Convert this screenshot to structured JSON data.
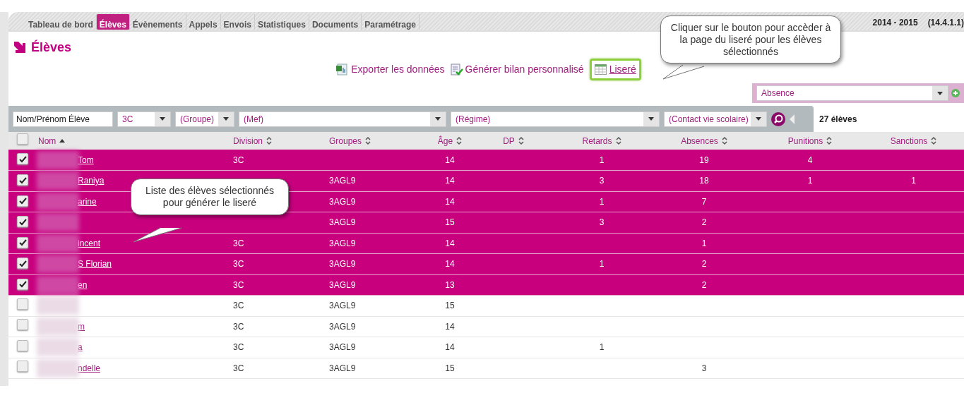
{
  "tabs": [
    {
      "label": "Tableau de bord",
      "selected": false
    },
    {
      "label": "Élèves",
      "selected": true
    },
    {
      "label": "Évènements",
      "selected": false
    },
    {
      "label": "Appels",
      "selected": false
    },
    {
      "label": "Envois",
      "selected": false
    },
    {
      "label": "Statistiques",
      "selected": false
    },
    {
      "label": "Documents",
      "selected": false
    },
    {
      "label": "Paramétrage",
      "selected": false
    }
  ],
  "school_year": "2014 - 2015",
  "version": "(14.4.1.1)",
  "page_title": "Élèves",
  "actions": [
    {
      "label": "Exporter les données",
      "kind": "export",
      "highlighted": false
    },
    {
      "label": "Générer bilan personnalisé",
      "kind": "report",
      "highlighted": false
    },
    {
      "label": "Liseré",
      "kind": "table",
      "highlighted": true
    }
  ],
  "event_select": {
    "value": "Absence"
  },
  "filters": [
    {
      "kind": "text",
      "value": "Nom/Prénom Élève"
    },
    {
      "kind": "select",
      "value": "3C"
    },
    {
      "kind": "select",
      "value": "(Groupe)"
    },
    {
      "kind": "select",
      "value": "(Mef)"
    },
    {
      "kind": "select",
      "value": "(Régime)"
    },
    {
      "kind": "select",
      "value": "(Contact vie scolaire)"
    }
  ],
  "student_count": "27 élèves",
  "table": {
    "all_checked": false,
    "columns": [
      {
        "label": "Nom",
        "sorted": true
      },
      {
        "label": "Division",
        "sorted": false
      },
      {
        "label": "Groupes",
        "sorted": false
      },
      {
        "label": "Âge",
        "sorted": false
      },
      {
        "label": "DP",
        "sorted": false
      },
      {
        "label": "Retards",
        "sorted": false
      },
      {
        "label": "Absences",
        "sorted": false
      },
      {
        "label": "Punitions",
        "sorted": false
      },
      {
        "label": "Sanctions",
        "sorted": false
      }
    ],
    "rows": [
      {
        "selected": true,
        "cells": [
          "Tom",
          "3C",
          null,
          "14",
          null,
          "1",
          "19",
          "4",
          null
        ]
      },
      {
        "selected": true,
        "cells": [
          "Raniya",
          null,
          "3AGL9",
          "14",
          null,
          "3",
          "18",
          "1",
          "1"
        ]
      },
      {
        "selected": true,
        "cells": [
          "arine",
          null,
          "3AGL9",
          "14",
          null,
          "1",
          "7",
          null,
          null
        ]
      },
      {
        "selected": true,
        "cells": [
          null,
          null,
          "3AGL9",
          "15",
          null,
          "3",
          "2",
          null,
          null
        ]
      },
      {
        "selected": true,
        "cells": [
          "incent",
          "3C",
          "3AGL9",
          "14",
          null,
          null,
          "1",
          null,
          null
        ]
      },
      {
        "selected": true,
        "cells": [
          "S Florian",
          "3C",
          "3AGL9",
          "14",
          null,
          "1",
          "2",
          null,
          null
        ]
      },
      {
        "selected": true,
        "cells": [
          "en",
          "3C",
          "3AGL9",
          "13",
          null,
          null,
          "2",
          null,
          null
        ]
      },
      {
        "selected": false,
        "cells": [
          null,
          "3C",
          "3AGL9",
          "15",
          null,
          null,
          null,
          null,
          null
        ]
      },
      {
        "selected": false,
        "cells": [
          "m",
          "3C",
          "3AGL9",
          "14",
          null,
          null,
          null,
          null,
          null
        ]
      },
      {
        "selected": false,
        "cells": [
          "a",
          "3C",
          "3AGL9",
          "14",
          null,
          "1",
          null,
          null,
          null
        ]
      },
      {
        "selected": false,
        "cells": [
          "ndelle",
          "3C",
          "3AGL9",
          "15",
          null,
          null,
          "3",
          null,
          null
        ]
      }
    ]
  },
  "callouts": [
    {
      "text": "Cliquer sur le bouton pour accèder à la page du liseré pour les élèves sélectionnés"
    },
    {
      "text": "Liste des élèves sélectionnés pour générer le liseré"
    }
  ]
}
